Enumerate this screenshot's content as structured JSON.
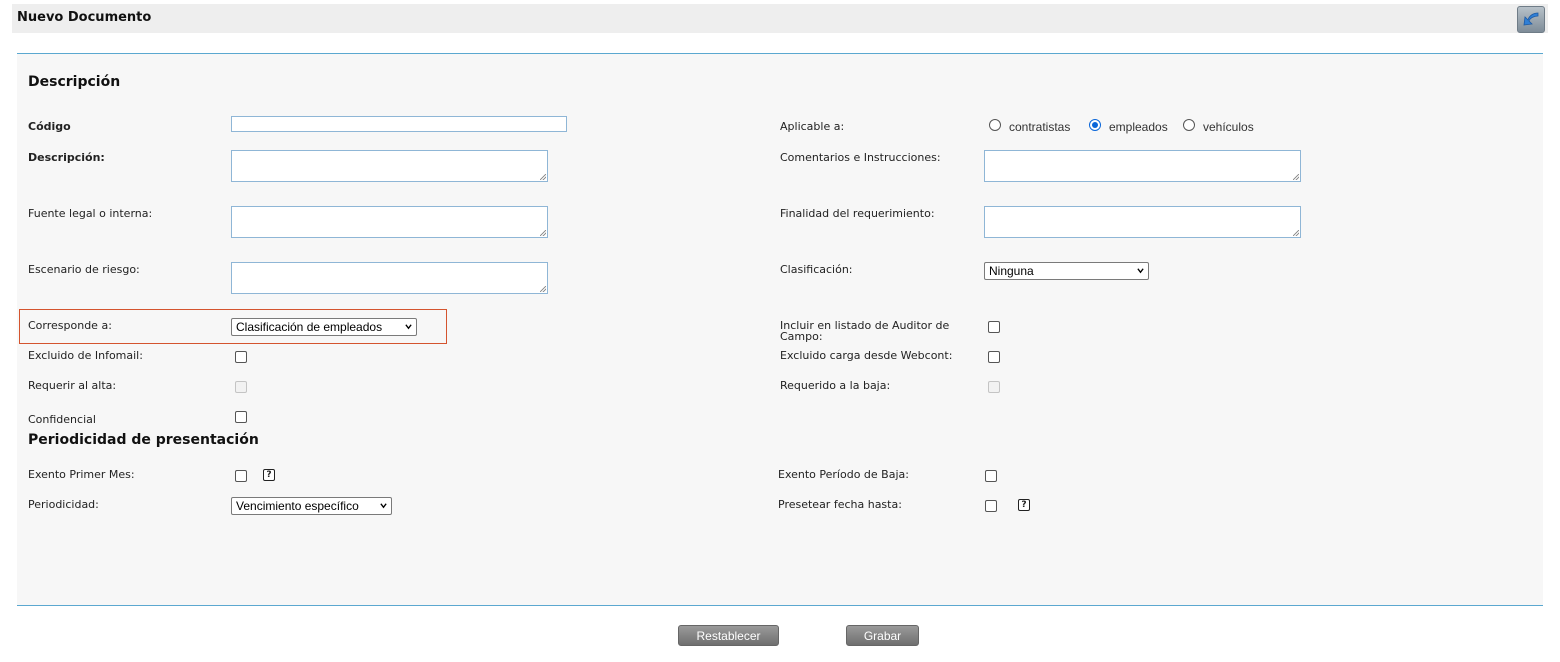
{
  "header": {
    "title": "Nuevo Documento",
    "back_icon": "back-arrow-icon"
  },
  "sections": {
    "descripcion": "Descripción",
    "periodicidad": "Periodicidad de presentación"
  },
  "left": {
    "codigo_label": "Código",
    "codigo_value": "",
    "descripcion_label": "Descripción:",
    "fuente_label": "Fuente legal o interna:",
    "escenario_label": "Escenario de riesgo:",
    "corresponde_label": "Corresponde a:",
    "corresponde_value": "Clasificación de empleados",
    "excluido_infomail_label": "Excluido de Infomail:",
    "requerir_alta_label": "Requerir al alta:",
    "confidencial_label": "Confidencial"
  },
  "right": {
    "aplicable_label": "Aplicable a:",
    "aplicable_options": [
      "contratistas",
      "empleados",
      "vehículos"
    ],
    "aplicable_selected": "empleados",
    "comentarios_label": "Comentarios e Instrucciones:",
    "finalidad_label": "Finalidad del requerimiento:",
    "clasificacion_label": "Clasificación:",
    "clasificacion_value": "Ninguna",
    "incluir_auditor_label_1": "Incluir en listado de Auditor de",
    "incluir_auditor_label_2": "Campo:",
    "excluido_webcont_label": "Excluido carga desde Webcont:",
    "requerido_baja_label": "Requerido a la baja:"
  },
  "periodicidad": {
    "exento_primer_mes_label": "Exento Primer Mes:",
    "periodicidad_label": "Periodicidad:",
    "periodicidad_value": "Vencimiento específico",
    "exento_baja_label": "Exento Período de Baja:",
    "presetear_label": "Presetear fecha hasta:",
    "help_glyph": "?"
  },
  "buttons": {
    "restablecer": "Restablecer",
    "grabar": "Grabar"
  },
  "colors": {
    "accent_line": "#5ba8d0",
    "highlight": "#d4542e",
    "radio_checked": "#0a66d9"
  }
}
